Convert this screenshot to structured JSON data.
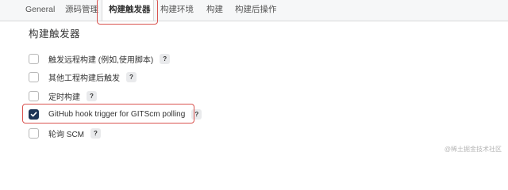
{
  "tabs": [
    {
      "label": "General"
    },
    {
      "label": "源码管理"
    },
    {
      "label": "构建触发器"
    },
    {
      "label": "构建环境"
    },
    {
      "label": "构建"
    },
    {
      "label": "构建后操作"
    }
  ],
  "active_tab": "构建触发器",
  "section": {
    "title": "构建触发器"
  },
  "options": [
    {
      "label": "触发远程构建 (例如,使用脚本)",
      "checked": false,
      "help": "?"
    },
    {
      "label": "其他工程构建后触发",
      "checked": false,
      "help": "?"
    },
    {
      "label": "定时构建",
      "checked": false,
      "help": "?"
    },
    {
      "label": "GitHub hook trigger for GITScm polling",
      "checked": true,
      "help": "?"
    },
    {
      "label": "轮询 SCM",
      "checked": false,
      "help": "?"
    }
  ],
  "watermark": "@稀土掘金技术社区",
  "colors": {
    "highlight": "#d9534f",
    "checkbox_checked": "#1d3557",
    "tab_bar": "#f6f7f8"
  },
  "icons": {
    "checkmark": "check-icon",
    "help": "help-icon"
  }
}
